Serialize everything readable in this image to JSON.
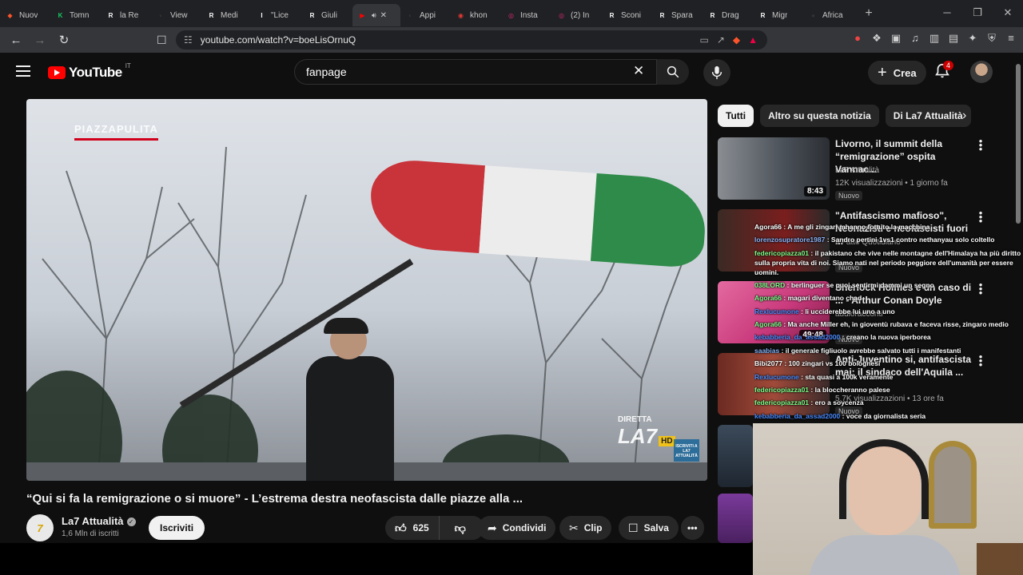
{
  "browser": {
    "tabs": [
      {
        "label": "Nuov",
        "color": "#fb542b",
        "glyph": "◆"
      },
      {
        "label": "Tomn",
        "color": "#17c964",
        "glyph": "K"
      },
      {
        "label": "la Re",
        "color": "#ffffff",
        "glyph": "R"
      },
      {
        "label": "View",
        "color": "#333333",
        "glyph": "◐"
      },
      {
        "label": "Medi",
        "color": "#ffffff",
        "glyph": "R"
      },
      {
        "label": "\"Lice",
        "color": "#ffffff",
        "glyph": "I"
      },
      {
        "label": "Giuli",
        "color": "#ffffff",
        "glyph": "R"
      },
      {
        "label": "",
        "color": "#ff0000",
        "glyph": "▶",
        "active": true
      },
      {
        "label": "Appi",
        "color": "#333333",
        "glyph": "◐"
      },
      {
        "label": "khon",
        "color": "#e53935",
        "glyph": "◉"
      },
      {
        "label": "Insta",
        "color": "#d62976",
        "glyph": "◎"
      },
      {
        "label": "(2) In",
        "color": "#d62976",
        "glyph": "◎"
      },
      {
        "label": "Sconi",
        "color": "#ffffff",
        "glyph": "R"
      },
      {
        "label": "Spara",
        "color": "#ffffff",
        "glyph": "R"
      },
      {
        "label": "Drag",
        "color": "#ffffff",
        "glyph": "R"
      },
      {
        "label": "Migr",
        "color": "#ffffff",
        "glyph": "R"
      },
      {
        "label": "Africa",
        "color": "#333333",
        "glyph": "●"
      }
    ],
    "new_tab": "+",
    "url": "youtube.com/watch?v=boeLisOrnuQ"
  },
  "header": {
    "logo_text": "YouTube",
    "logo_region": "IT",
    "search_value": "fanpage",
    "create_label": "Crea",
    "notification_count": "4"
  },
  "video": {
    "title": "“Qui si fa la remigrazione o si muore” - L’estrema destra neofascista dalle piazze alla ...",
    "watermark_top": "PIAZZAPULITA",
    "watermark_diretta": "DIRETTA",
    "watermark_la7": "LA7",
    "watermark_hd": "HD",
    "watermark_att": "ISCRIVITI A LA7 ATTUALITÀ",
    "channel_name": "La7 Attualità",
    "channel_subs": "1,6 Mln di iscritti",
    "subscribe_label": "Iscriviti",
    "likes": "625",
    "share_label": "Condividi",
    "clip_label": "Clip",
    "save_label": "Salva"
  },
  "sidebar": {
    "chips": [
      "Tutti",
      "Altro su questa notizia",
      "Di La7 Attualità"
    ],
    "recommendations": [
      {
        "title": "Livorno, il summit della “remigrazione” ospita Vannac...",
        "channel": "La7 Attualità",
        "meta": "12K visualizzazioni • 1 giorno fa",
        "badge": "Nuovo",
        "duration": "8:43"
      },
      {
        "title": "\"Antifascismo mafioso\", Neonazisti e neofascisti fuori ...",
        "channel": "Il Fatto Quotidiano",
        "meta": "",
        "badge": "Nuovo",
        "duration": ""
      },
      {
        "title": "Sherlock Holmes e un caso di ... - Arthur Conan Doyle",
        "channel": "audioracconti",
        "meta": "",
        "badge": "Nuovo",
        "duration": "49:48"
      },
      {
        "title": "Anti-Juventino si, antifascista mai: il sindaco dell'Aquila ...",
        "channel": "",
        "meta": "5,7K visualizzazioni • 13 ore fa",
        "badge": "Nuovo",
        "duration": ""
      }
    ]
  },
  "chat": [
    {
      "user": "Agora66",
      "color": "#ffffff",
      "text": "A me gli zingari mhanno fottuto la macchina"
    },
    {
      "user": "lorenzosupratore1987",
      "color": "#8ab4f8",
      "text": "Sandro pertini 1vs1 contro nethanyau solo coltello"
    },
    {
      "user": "federicopiazza01",
      "color": "#7dff8a",
      "text": "il pakistano che vive nelle montagne dell'Himalaya ha più diritto sulla propria vita di noi. Siamo nati nel periodo peggiore dell'umanità per essere uomini.",
      "wrap": true
    },
    {
      "user": "038LORD",
      "color": "#7dff8a",
      "text": "berlinguer se puoi sentirmi dammi un segno"
    },
    {
      "user": "Agora66",
      "color": "#7dff8a",
      "text": "magari diventano chad"
    },
    {
      "user": "Rexlucumone",
      "color": "#4a8cff",
      "text": "li ucciderebbe lui uno a uno"
    },
    {
      "user": "Agora66",
      "color": "#7dff8a",
      "text": "Ma anche Miller eh, in gioventù rubava e faceva risse, zingaro medio"
    },
    {
      "user": "kebabberia_da_assad2000",
      "color": "#4a8cff",
      "text": "creano la nuova iperborea"
    },
    {
      "user": "saabias",
      "color": "#8ab4f8",
      "text": "il generale figliuolo avrebbe salvato tutti i manifestanti"
    },
    {
      "user": "Bibi2077",
      "color": "#ffffff",
      "text": "100 zingari vs 100 bolognesi"
    },
    {
      "user": "Rexlucumone",
      "color": "#4a8cff",
      "text": "sta quasi a 100k veramente"
    },
    {
      "user": "federicopiazza01",
      "color": "#7dff8a",
      "text": "la bloccheranno palese"
    },
    {
      "user": "federicopiazza01",
      "color": "#7dff8a",
      "text": "ero a soycenza"
    },
    {
      "user": "kebabberia_da_assad2000",
      "color": "#4a8cff",
      "text": "voce da giornalista seria"
    }
  ]
}
